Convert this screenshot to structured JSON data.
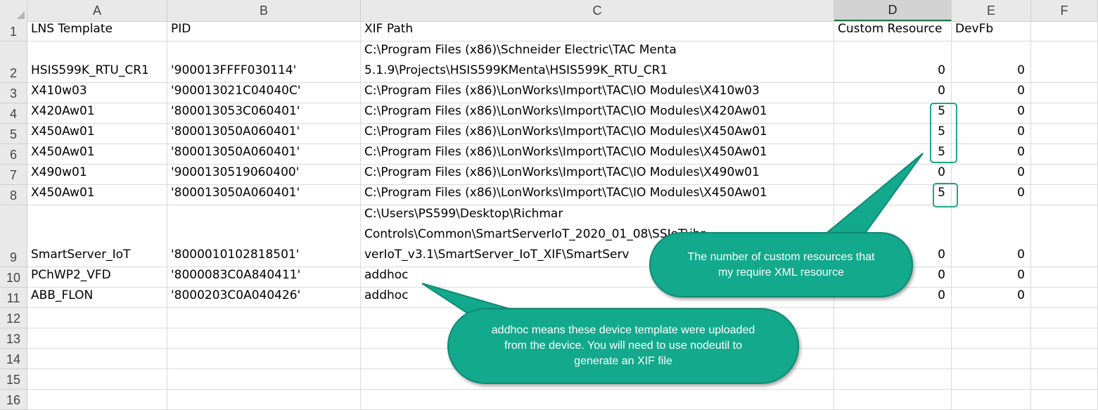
{
  "columns": [
    "A",
    "B",
    "C",
    "D",
    "E",
    "F"
  ],
  "selected_column": "D",
  "rows": [
    {
      "n": "1",
      "a": [
        "LNS Template"
      ],
      "b": [
        "PID"
      ],
      "c": [
        "XIF Path"
      ],
      "d": [
        "Custom Resource"
      ],
      "e": [
        "DevFb"
      ],
      "num": false
    },
    {
      "n": "2",
      "a": [
        "HSIS599K_RTU_CR1"
      ],
      "b": [
        "'900013FFFF030114'"
      ],
      "c": [
        "C:\\Program Files (x86)\\Schneider Electric\\TAC Menta",
        "5.1.9\\Projects\\HSIS599KMenta\\HSIS599K_RTU_CR1"
      ],
      "d": [
        "0"
      ],
      "e": [
        "0"
      ],
      "num": true
    },
    {
      "n": "3",
      "a": [
        "X410w03"
      ],
      "b": [
        "'900013021C04040C'"
      ],
      "c": [
        "C:\\Program Files (x86)\\LonWorks\\Import\\TAC\\IO Modules\\X410w03"
      ],
      "d": [
        "0"
      ],
      "e": [
        "0"
      ],
      "num": true
    },
    {
      "n": "4",
      "a": [
        "X420Aw01"
      ],
      "b": [
        "'800013053C060401'"
      ],
      "c": [
        "C:\\Program Files (x86)\\LonWorks\\Import\\TAC\\IO Modules\\X420Aw01"
      ],
      "d": [
        "5"
      ],
      "e": [
        "0"
      ],
      "num": true
    },
    {
      "n": "5",
      "a": [
        "X450Aw01"
      ],
      "b": [
        "'800013050A060401'"
      ],
      "c": [
        "C:\\Program Files (x86)\\LonWorks\\Import\\TAC\\IO Modules\\X450Aw01"
      ],
      "d": [
        "5"
      ],
      "e": [
        "0"
      ],
      "num": true
    },
    {
      "n": "6",
      "a": [
        "X450Aw01"
      ],
      "b": [
        "'800013050A060401'"
      ],
      "c": [
        "C:\\Program Files (x86)\\LonWorks\\Import\\TAC\\IO Modules\\X450Aw01"
      ],
      "d": [
        "5"
      ],
      "e": [
        "0"
      ],
      "num": true
    },
    {
      "n": "7",
      "a": [
        "X490w01"
      ],
      "b": [
        "'9000130519060400'"
      ],
      "c": [
        "C:\\Program Files (x86)\\LonWorks\\Import\\TAC\\IO Modules\\X490w01"
      ],
      "d": [
        "0"
      ],
      "e": [
        "0"
      ],
      "num": true
    },
    {
      "n": "8",
      "a": [
        "X450Aw01"
      ],
      "b": [
        "'800013050A060401'"
      ],
      "c": [
        "C:\\Program Files (x86)\\LonWorks\\Import\\TAC\\IO Modules\\X450Aw01"
      ],
      "d": [
        "5"
      ],
      "e": [
        "0"
      ],
      "num": true
    },
    {
      "n": "9",
      "a": [
        "SmartServer_IoT"
      ],
      "b": [
        "'8000010102818501'"
      ],
      "c": [
        "C:\\Users\\PS599\\Desktop\\Richmar",
        "Controls\\Common\\SmartServerIoT_2020_01_08\\SSIoT\\ibr",
        "verIoT_v3.1\\SmartServer_IoT_XIF\\SmartServ"
      ],
      "d": [
        "0"
      ],
      "e": [
        "0"
      ],
      "num": true
    },
    {
      "n": "10",
      "a": [
        "PChWP2_VFD"
      ],
      "b": [
        "'8000083C0A840411'"
      ],
      "c": [
        "addhoc"
      ],
      "d": [
        "0"
      ],
      "e": [
        "0"
      ],
      "num": true
    },
    {
      "n": "11",
      "a": [
        "ABB_FLON"
      ],
      "b": [
        "'8000203C0A040426'"
      ],
      "c": [
        "addhoc"
      ],
      "d": [
        "0"
      ],
      "e": [
        "0"
      ],
      "num": true
    },
    {
      "n": "12",
      "a": [],
      "b": [],
      "c": [],
      "d": [],
      "e": [],
      "num": false
    },
    {
      "n": "13",
      "a": [],
      "b": [],
      "c": [],
      "d": [],
      "e": [],
      "num": false
    },
    {
      "n": "14",
      "a": [],
      "b": [],
      "c": [],
      "d": [],
      "e": [],
      "num": false
    },
    {
      "n": "15",
      "a": [],
      "b": [],
      "c": [],
      "d": [],
      "e": [],
      "num": false
    },
    {
      "n": "16",
      "a": [],
      "b": [],
      "c": [],
      "d": [],
      "e": [],
      "num": false
    }
  ],
  "callouts": {
    "custom_resources": "The number of custom resources that my require XML resource",
    "addhoc": "addhoc means these device template were uploaded from the device.  You will need to use nodeutil to generate an XIF file"
  },
  "colors": {
    "callout_fill": "#13a98d",
    "highlight_border": "#1fa58a",
    "selected_col_underline": "#217346"
  }
}
